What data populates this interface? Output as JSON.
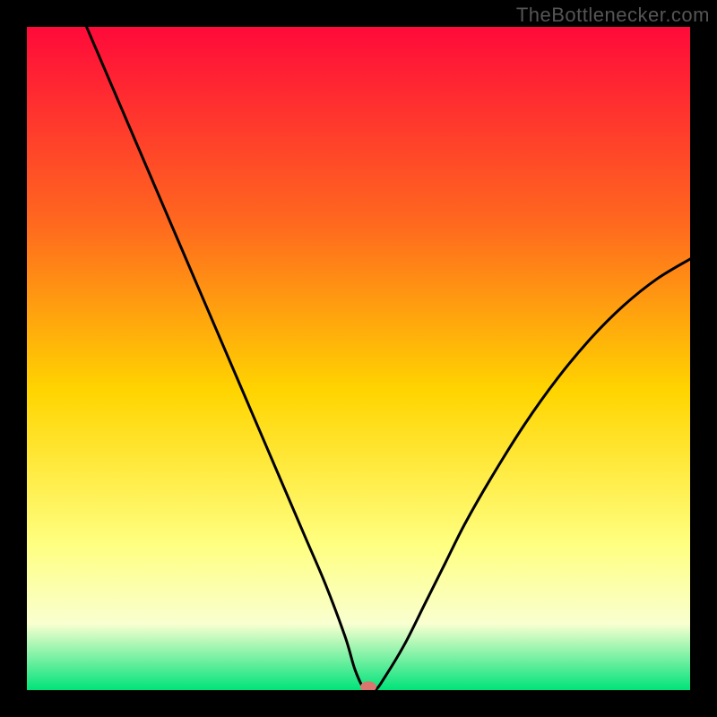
{
  "watermark": "TheBottlenecker.com",
  "colors": {
    "gradient_top": "#ff0a3a",
    "gradient_mid1": "#ff6a1e",
    "gradient_mid2": "#ffd500",
    "gradient_mid3": "#ffff80",
    "gradient_mid4": "#f9ffd0",
    "gradient_bottom": "#00e37a",
    "curve": "#000000",
    "frame": "#000000",
    "marker": "#d9776f"
  },
  "chart_data": {
    "type": "line",
    "title": "",
    "xlabel": "",
    "ylabel": "",
    "xlim": [
      0,
      100
    ],
    "ylim": [
      0,
      100
    ],
    "series": [
      {
        "name": "bottleneck-curve",
        "x": [
          9,
          12,
          15,
          18,
          21,
          24,
          27,
          30,
          33,
          36,
          39,
          42,
          45,
          48,
          49.5,
          51,
          52.5,
          54,
          57,
          60,
          63,
          66,
          70,
          75,
          80,
          85,
          90,
          95,
          100
        ],
        "y": [
          100,
          93,
          86,
          79,
          72,
          65,
          58,
          51,
          44,
          37,
          30,
          23,
          16,
          8,
          3,
          0,
          0,
          2,
          7,
          13,
          19,
          25,
          32,
          40,
          47,
          53,
          58,
          62,
          65
        ]
      }
    ],
    "marker": {
      "x": 51.5,
      "y": 0.5,
      "name": "optimal-point"
    }
  }
}
